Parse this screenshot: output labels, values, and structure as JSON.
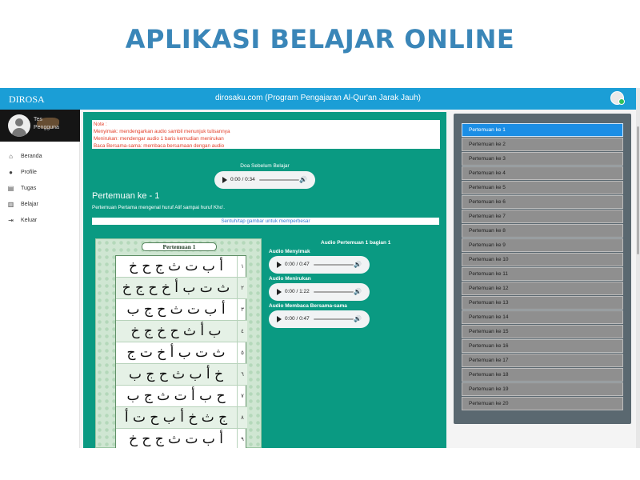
{
  "hero_title": "APLIKASI BELAJAR ONLINE",
  "header": {
    "brand": "DIROSA",
    "site_title": "dirosaku.com (Program Pengajaran Al-Qur'an Jarak Jauh)"
  },
  "profile": {
    "line1": "Tes",
    "line2": "Pengguna"
  },
  "sidebar": {
    "items": [
      {
        "label": "Beranda",
        "icon": "home-icon"
      },
      {
        "label": "Profile",
        "icon": "person-icon"
      },
      {
        "label": "Tugas",
        "icon": "tasks-icon"
      },
      {
        "label": "Belajar",
        "icon": "book-icon"
      },
      {
        "label": "Keluar",
        "icon": "logout-icon"
      }
    ]
  },
  "note": {
    "lines": [
      "Note :",
      "Menyimak: mendengarkan audio sambil menunjuk tulisannya",
      "Menirukan: mendengar audio 1 baris kemudian menirukan",
      "Baca Bersama-sama: membaca bersamaan dengan audio"
    ]
  },
  "doa": {
    "title": "Doa Sebelum Belajar",
    "time": "0:00 / 0:34"
  },
  "lesson": {
    "title": "Pertemuan ke - 1",
    "subtitle": "Pertemuan Pertama mengenal huruf Alif sampai huruf Kho'.",
    "tap_hint": "Sentuh/tap gambar untuk memperbesar"
  },
  "card": {
    "label": "Pertemuan 1",
    "rows": [
      {
        "num": "١",
        "text": "أ ب ت ث ج ح خ"
      },
      {
        "num": "٢",
        "text": "ث ت ب أ خ ح ج خ"
      },
      {
        "num": "٣",
        "text": "أ ب ت ث ح ج ب"
      },
      {
        "num": "٤",
        "text": "ب أ ث ح خ ج خ"
      },
      {
        "num": "٥",
        "text": "ث ت ب أ خ ت ج"
      },
      {
        "num": "٦",
        "text": "خ أ ب ث ح ج ب"
      },
      {
        "num": "٧",
        "text": "ح ب أ ت ث ج ب"
      },
      {
        "num": "٨",
        "text": "ج ث خ أ ب ح ت أ"
      },
      {
        "num": "٩",
        "text": "أ ب ت ث ج ح خ"
      }
    ]
  },
  "audio": {
    "section_title": "Audio Pertemuan 1 bagian 1",
    "players": [
      {
        "label": "Audio Menyimak",
        "time": "0:00 / 0:47"
      },
      {
        "label": "Audio Menirukan",
        "time": "0:00 / 1:22"
      },
      {
        "label": "Audio Membaca Bersama-sama",
        "time": "0:00 / 0:47"
      }
    ]
  },
  "meetings": {
    "items": [
      "Pertemuan ke 1",
      "Pertemuan ke 2",
      "Pertemuan ke 3",
      "Pertemuan ke 4",
      "Pertemuan ke 5",
      "Pertemuan ke 6",
      "Pertemuan ke 7",
      "Pertemuan ke 8",
      "Pertemuan ke 9",
      "Pertemuan ke 10",
      "Pertemuan ke 11",
      "Pertemuan ke 12",
      "Pertemuan ke 13",
      "Pertemuan ke 14",
      "Pertemuan ke 15",
      "Pertemuan ke 16",
      "Pertemuan ke 17",
      "Pertemuan ke 18",
      "Pertemuan ke 19",
      "Pertemuan ke 20"
    ],
    "active": "Pertemuan ke 1"
  },
  "colors": {
    "accent": "#1b9ed6",
    "main_bg": "#0a9a82",
    "panel_bg": "#5a6870",
    "active_item": "#1b8ee5",
    "hero": "#3a86b8"
  }
}
